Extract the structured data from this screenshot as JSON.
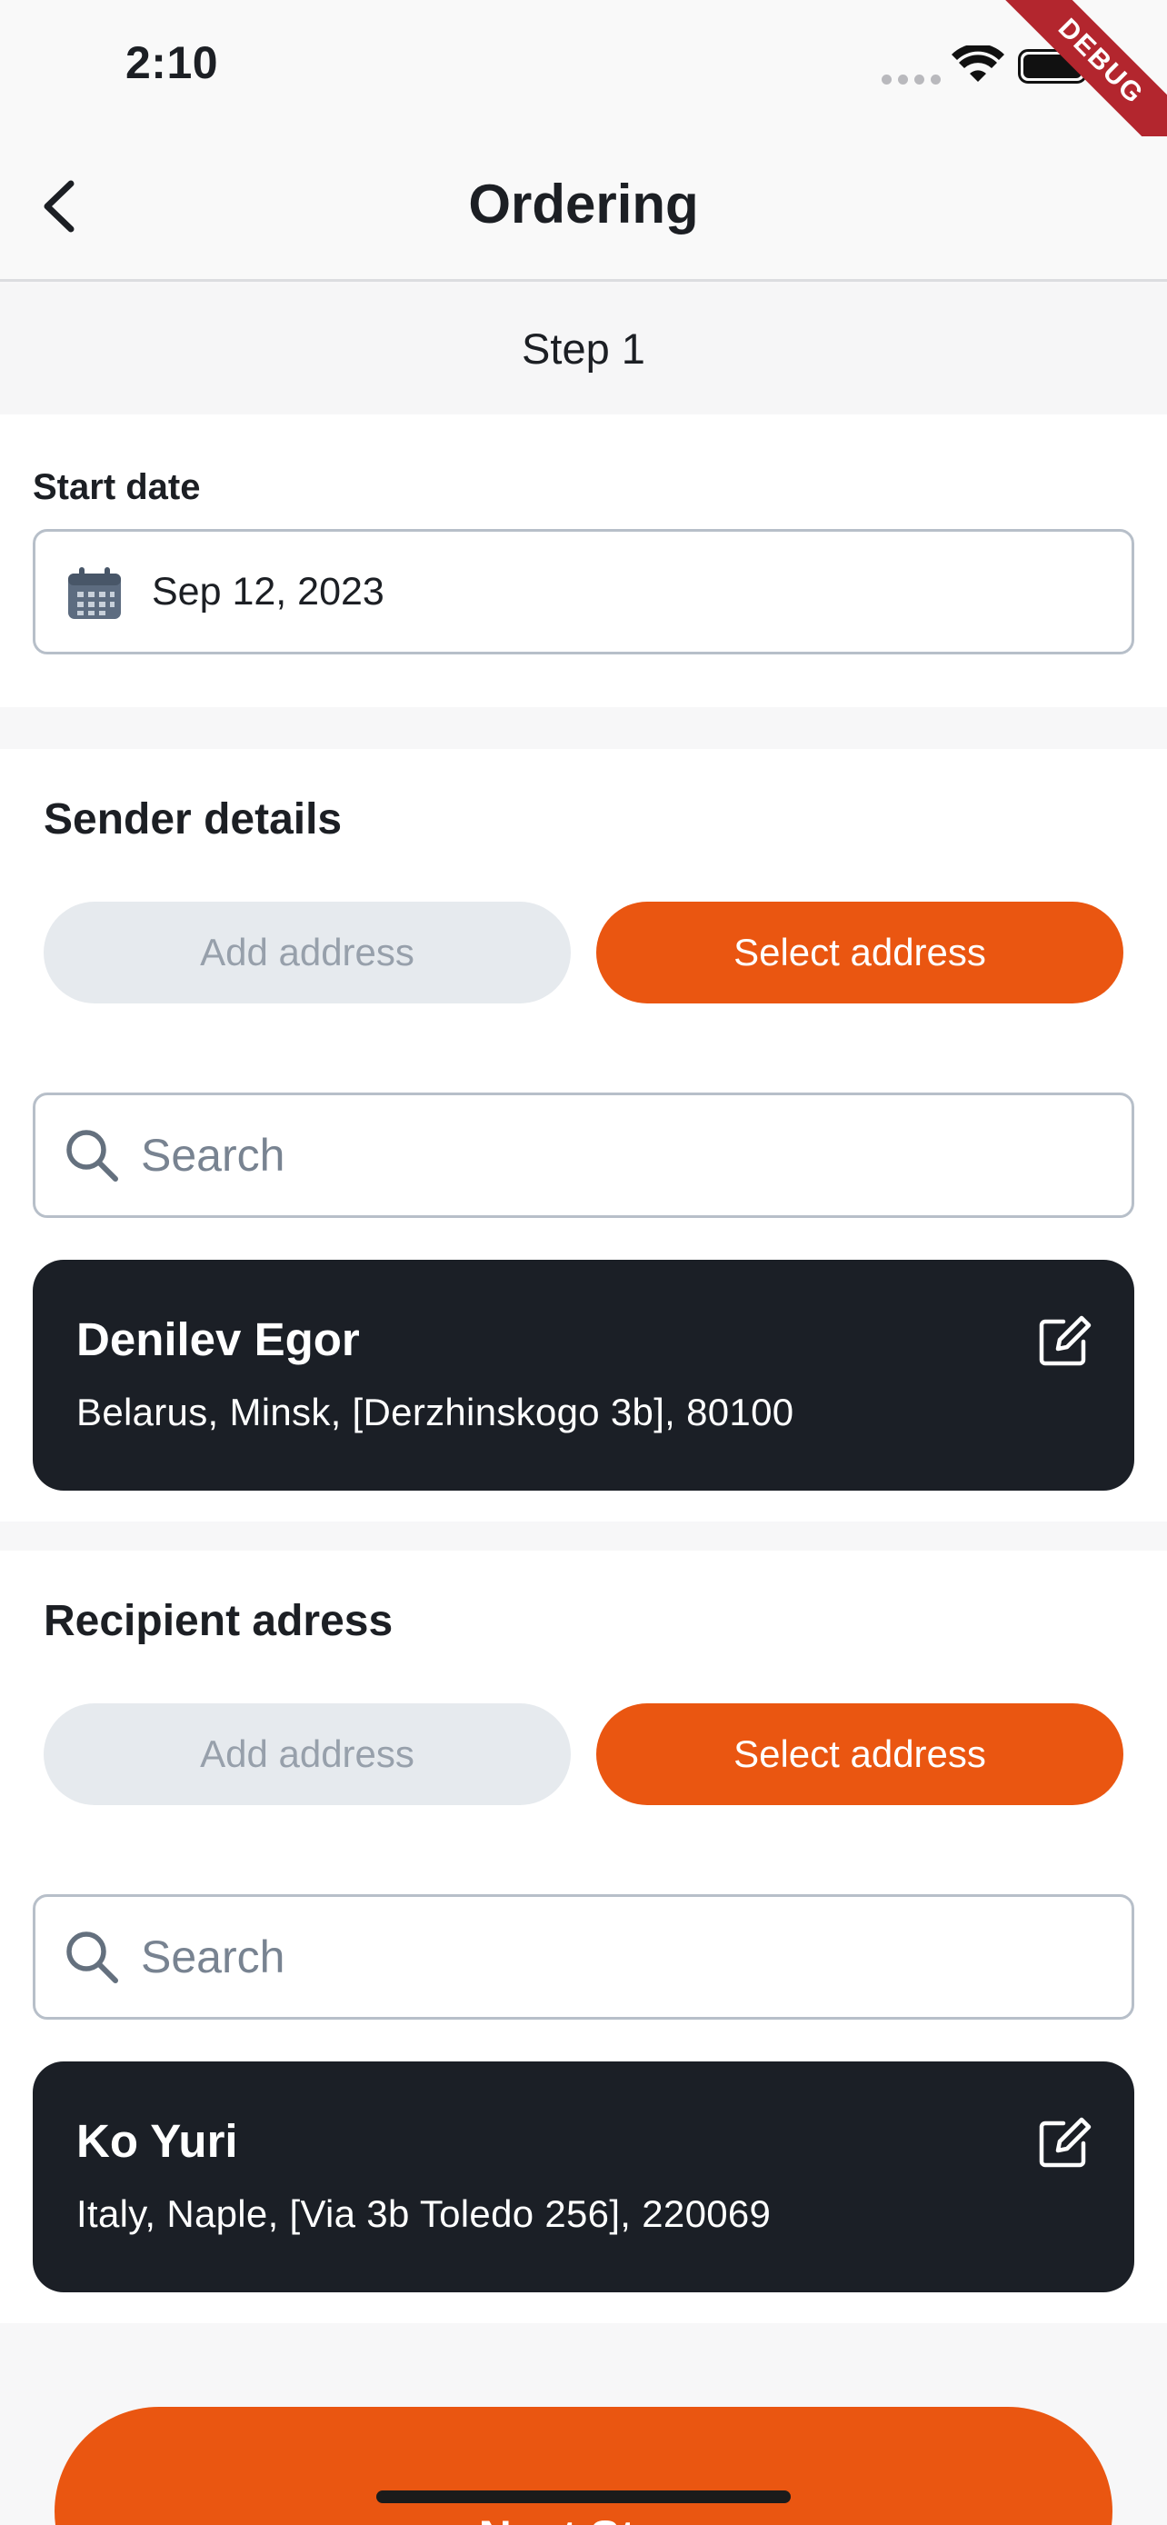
{
  "status_bar": {
    "time": "2:10",
    "debug_label": "DEBUG"
  },
  "app_bar": {
    "title": "Ordering",
    "back_icon": "chevron-left-icon"
  },
  "step": {
    "label": "Step 1"
  },
  "start_date": {
    "label": "Start date",
    "value": "Sep 12, 2023",
    "icon": "calendar-icon"
  },
  "sender": {
    "title": "Sender details",
    "add_label": "Add address",
    "select_label": "Select address",
    "search_placeholder": "Search",
    "card": {
      "name": "Denilev Egor",
      "address": "Belarus, Minsk, [Derzhinskogo 3b], 80100",
      "icon": "edit-icon"
    }
  },
  "recipient": {
    "title": "Recipient adress",
    "add_label": "Add address",
    "select_label": "Select address",
    "search_placeholder": "Search",
    "card": {
      "name": "Ko Yuri",
      "address": "Italy, Naple, [Via 3b Toledo 256], 220069",
      "icon": "edit-icon"
    }
  },
  "footer": {
    "next_label": "Next Step"
  },
  "colors": {
    "accent": "#ea5611",
    "card_dark": "#1b1f26",
    "pill_inactive": "#e6eaee"
  }
}
